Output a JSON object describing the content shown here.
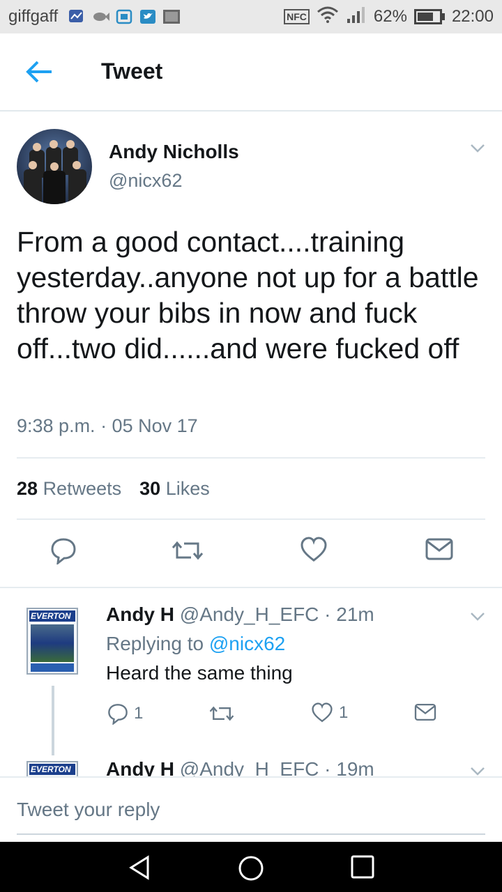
{
  "status_bar": {
    "carrier": "giffgaff",
    "battery": "62%",
    "time": "22:00",
    "nfc": "NFC",
    "notification_icons": [
      "chart-icon",
      "fish-icon",
      "image-icon",
      "twitter-icon",
      "photo-icon"
    ]
  },
  "header": {
    "title": "Tweet"
  },
  "tweet": {
    "author_name": "Andy Nicholls",
    "author_handle": "@nicx62",
    "text": "From a good contact....training yesterday..anyone not up for a battle throw your bibs in now and fuck off...two did......and were fucked off",
    "timestamp": "9:38 p.m. · 05 Nov 17",
    "retweets_count": "28",
    "retweets_label": "Retweets",
    "likes_count": "30",
    "likes_label": "Likes"
  },
  "replies": [
    {
      "name": "Andy H",
      "handle_time": "@Andy_H_EFC · 21m",
      "replying_prefix": "Replying to",
      "replying_to": "@nicx62",
      "text": "Heard the same thing",
      "reply_count": "1",
      "like_count": "1",
      "club_label": "EVERTON"
    },
    {
      "name": "Andy H",
      "handle_time": "@Andy_H_EFC · 19m",
      "club_label": "EVERTON"
    }
  ],
  "compose": {
    "placeholder": "Tweet your reply"
  },
  "colors": {
    "accent": "#1da1f2",
    "text_primary": "#14171a",
    "text_secondary": "#657786",
    "divider": "#e6ecf0"
  }
}
